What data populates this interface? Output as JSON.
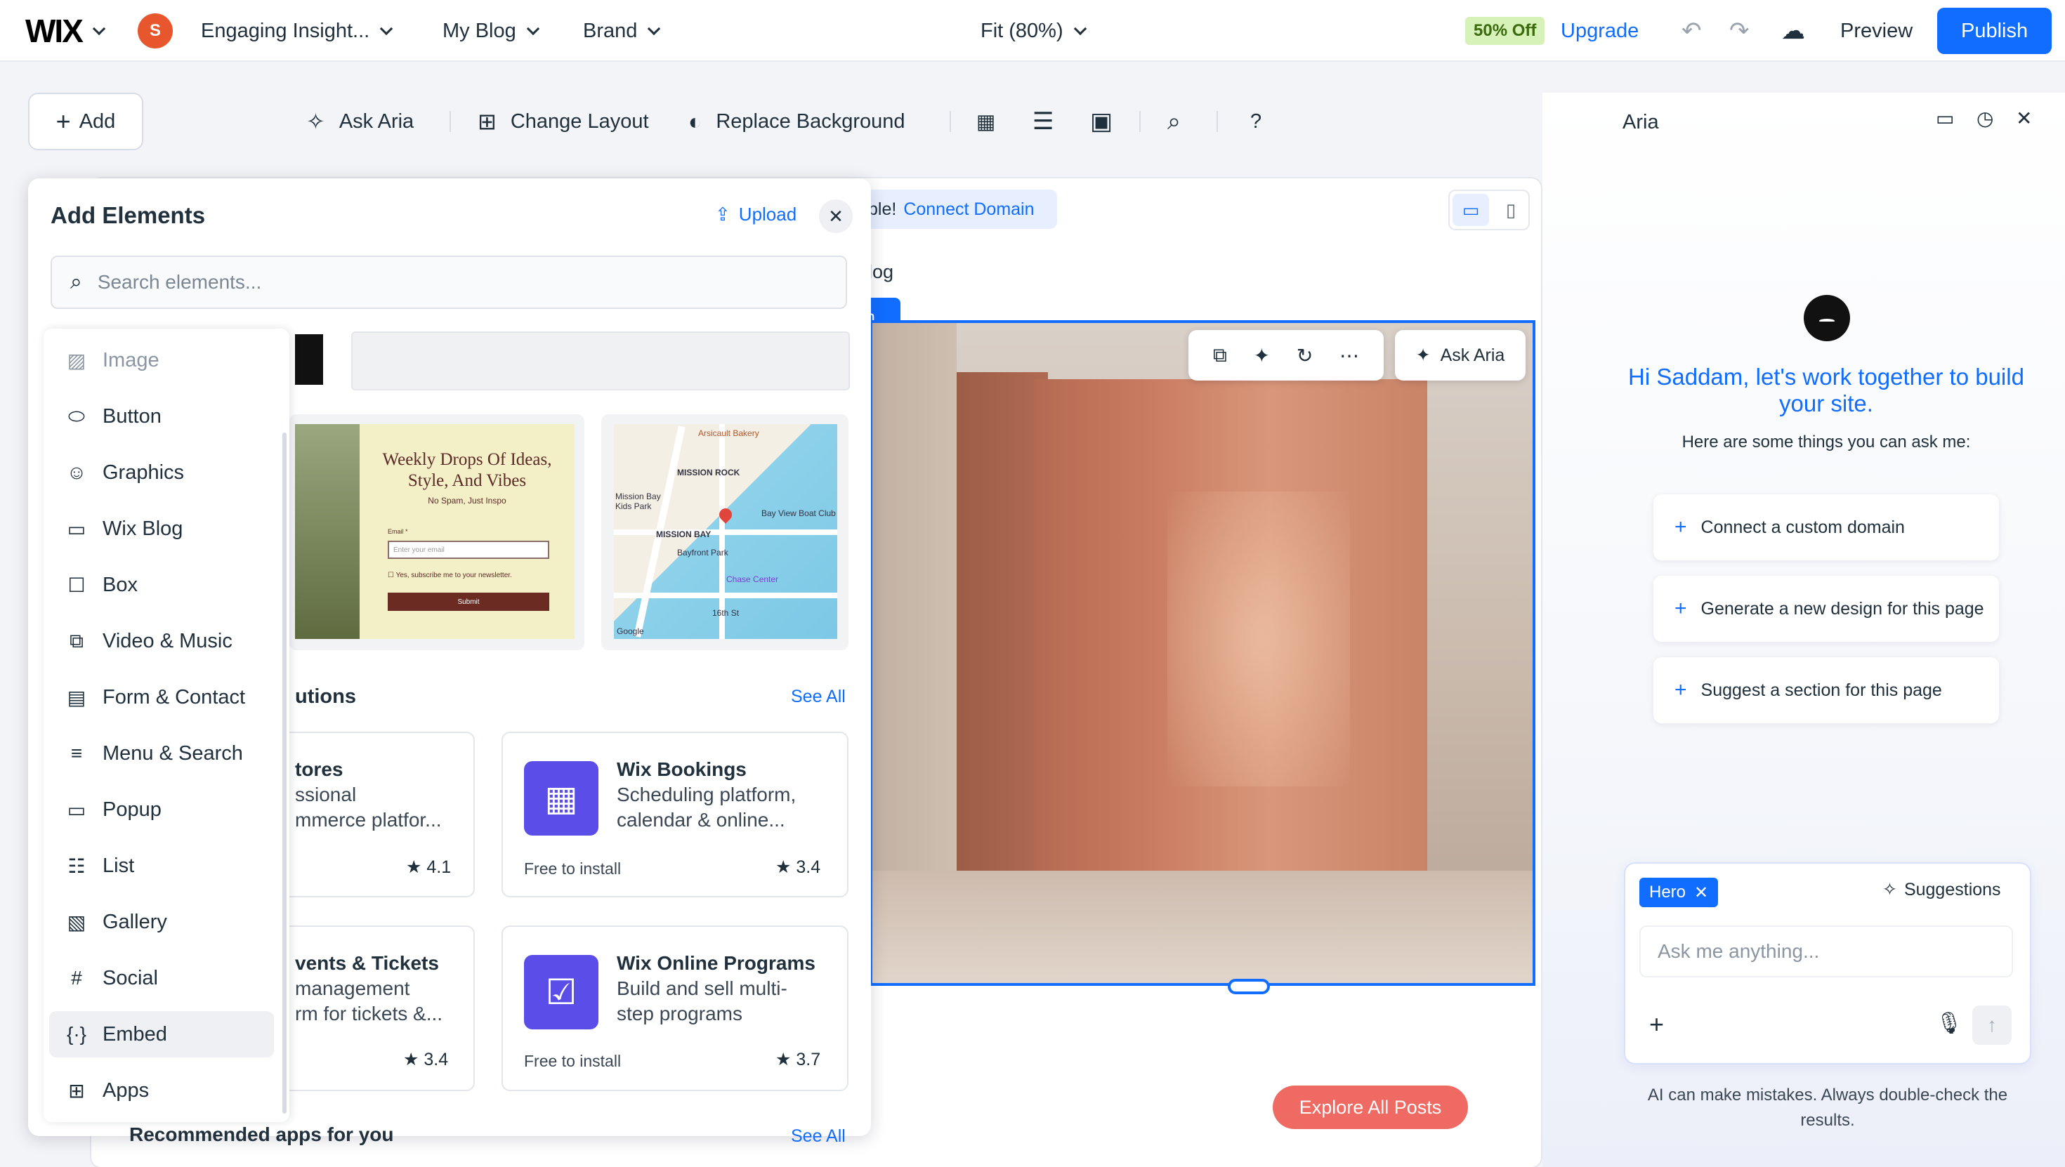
{
  "topbar": {
    "logo": "WIX",
    "avatar_initial": "S",
    "site_name": "Engaging Insight...",
    "page_name": "My Blog",
    "brand": "Brand",
    "zoom": "Fit (80%)",
    "promo": "50% Off",
    "upgrade": "Upgrade",
    "preview": "Preview",
    "publish": "Publish"
  },
  "toolbar": {
    "add": "Add",
    "ask_aria": "Ask Aria",
    "change_layout": "Change Layout",
    "replace_background": "Replace Background",
    "help": "?"
  },
  "panel": {
    "title": "Add Elements",
    "upload": "Upload",
    "search_placeholder": "Search elements...",
    "categories": [
      {
        "label": "Image",
        "icon": "image-icon"
      },
      {
        "label": "Button",
        "icon": "button-icon"
      },
      {
        "label": "Graphics",
        "icon": "graphics-icon"
      },
      {
        "label": "Wix Blog",
        "icon": "blog-icon"
      },
      {
        "label": "Box",
        "icon": "box-icon"
      },
      {
        "label": "Video & Music",
        "icon": "video-icon"
      },
      {
        "label": "Form & Contact",
        "icon": "form-icon"
      },
      {
        "label": "Menu & Search",
        "icon": "menu-icon"
      },
      {
        "label": "Popup",
        "icon": "popup-icon"
      },
      {
        "label": "List",
        "icon": "list-icon"
      },
      {
        "label": "Gallery",
        "icon": "gallery-icon"
      },
      {
        "label": "Social",
        "icon": "hashtag-icon"
      },
      {
        "label": "Embed",
        "icon": "embed-icon"
      },
      {
        "label": "Apps",
        "icon": "apps-icon"
      }
    ],
    "newsletter": {
      "title": "Weekly Drops Of Ideas, Style, And Vibes",
      "sub": "No Spam, Just Inspo",
      "email_label": "Email *",
      "input_placeholder": "Enter your email",
      "checkbox": "Yes, subscribe me to your newsletter.",
      "submit": "Submit"
    },
    "map": {
      "labels": [
        "Arsicault Bakery",
        "MISSION ROCK",
        "Mission Bay Kids Park",
        "MISSION BAY",
        "Bay View Boat Club",
        "Bayfront Park",
        "Chase Center",
        "Google",
        "16th St"
      ]
    },
    "section_title": "utions",
    "see_all": "See All",
    "apps": [
      {
        "name": "tores",
        "desc1": "ssional",
        "desc2": "mmerce platfor...",
        "free": "",
        "rating": "4.1"
      },
      {
        "name": "Wix Bookings",
        "desc1": "Scheduling platform,",
        "desc2": "calendar & online...",
        "free": "Free to install",
        "rating": "3.4"
      },
      {
        "name": "vents & Tickets",
        "desc1": " management",
        "desc2": "rm for tickets &...",
        "free": "",
        "rating": "3.4"
      },
      {
        "name": "Wix Online Programs",
        "desc1": "Build and sell multi-",
        "desc2": "step programs",
        "free": "Free to install",
        "rating": "3.7"
      }
    ],
    "recommended": "Recommended apps for you",
    "see_all_2": "See All"
  },
  "canvas": {
    "domain_prefix": "ble!",
    "domain_link": "Connect Domain",
    "blog_label": "log",
    "blue_tab": "n",
    "hero_ask_aria": "Ask Aria",
    "explore": "Explore All Posts"
  },
  "aria": {
    "title": "Aria",
    "greeting": "Hi Saddam, let's work together to build your site.",
    "sub": "Here are some things you can ask me:",
    "suggestions": [
      "Connect a custom domain",
      "Generate a new design for this page",
      "Suggest a section for this page"
    ],
    "chip": "Hero",
    "suggestions_label": "Suggestions",
    "input_placeholder": "Ask me anything...",
    "disclaimer": "AI can make mistakes. Always double-check the results."
  },
  "colors": {
    "accent": "#116dff",
    "promo_bg": "#d6f2b8",
    "explore_btn": "#ee6a63",
    "app_icon": "#5b4ee8"
  }
}
